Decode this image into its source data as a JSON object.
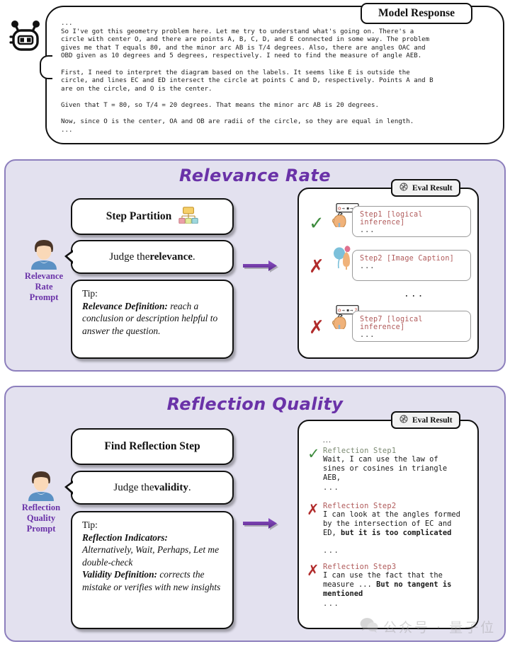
{
  "response": {
    "badge_label": "Model Response",
    "bot_icon": "robot-head-icon",
    "text": "...\nSo I've got this geometry problem here. Let me try to understand what's going on. There's a\ncircle with center O, and there are points A, B, C, D, and E connected in some way. The problem\ngives me that T equals 80, and the minor arc AB is T/4 degrees. Also, there are angles OAC and\nOBD given as 10 degrees and 5 degrees, respectively. I need to find the measure of angle AEB.\n\nFirst, I need to interpret the diagram based on the labels. It seems like E is outside the\ncircle, and lines EC and ED intersect the circle at points C and D, respectively. Points A and B\nare on the circle, and O is the center.\n\nGiven that T = 80, so T/4 = 20 degrees. That means the minor arc AB is 20 degrees.\n\nNow, since O is the center, OA and OB are radii of the circle, so they are equal in length.\n..."
  },
  "relevance": {
    "title": "Relevance Rate",
    "persona": {
      "avatar_icon": "person-avatar-icon",
      "label_line1": "Relevance",
      "label_line2": "Rate",
      "label_line3": "Prompt"
    },
    "step_partition_card": {
      "label": "Step Partition",
      "icon": "hierarchy-chart-icon"
    },
    "judge_card": {
      "prefix": "Judge the ",
      "keyword": "relevance",
      "suffix": "."
    },
    "tip_card": {
      "lead": "Tip:",
      "term": "Relevance Definition:",
      "desc": " reach a conclusion or description helpful to answer the question."
    },
    "arrow_icon": "right-arrow-icon",
    "eval": {
      "badge_label": "Eval Result",
      "badge_icon": "openai-logo-icon",
      "middle_ellipsis": "...",
      "steps": [
        {
          "mark": "check",
          "mark_glyph": "✓",
          "icon": "thinking-head-icon",
          "label": "Step1 [logical inference]",
          "body": "..."
        },
        {
          "mark": "cross",
          "mark_glyph": "✗",
          "icon": "image-caption-icon",
          "label": "Step2 [Image Caption]",
          "body": "..."
        },
        {
          "mark": "cross",
          "mark_glyph": "✗",
          "icon": "thinking-head-icon",
          "label": "Step7 [logical inference]",
          "body": "..."
        }
      ]
    }
  },
  "reflection": {
    "title": "Reflection Quality",
    "persona": {
      "avatar_icon": "person-avatar-icon",
      "label_line1": "Reflection",
      "label_line2": "Quality",
      "label_line3": "Prompt"
    },
    "find_card": {
      "label": "Find Reflection Step"
    },
    "judge_card": {
      "prefix": "Judge the ",
      "keyword": "validity",
      "suffix": "."
    },
    "tip_card": {
      "lead": "Tip:",
      "term1": "Reflection Indicators:",
      "desc1": "Alternatively, Wait, Perhaps, Let me double-check",
      "term2": "Validity Definition:",
      "desc2": " corrects the mistake or verifies with new insights"
    },
    "arrow_icon": "right-arrow-icon",
    "eval": {
      "badge_label": "Eval Result",
      "badge_icon": "openai-logo-icon",
      "top_ellipsis": "...",
      "steps": [
        {
          "mark": "check",
          "mark_glyph": "✓",
          "label": "Reflection Step1",
          "text_plain": "Wait, I can use the law of\nsines or cosines in triangle\nAEB,",
          "text_bold": "",
          "trailing_dots": "..."
        },
        {
          "mark": "cross",
          "mark_glyph": "✗",
          "label": "Reflection Step2",
          "text_plain": "I can look at the angles formed\nby the intersection of EC and\nED, ",
          "text_bold": "but it is too complicated",
          "trailing_dots": "..."
        },
        {
          "mark": "cross",
          "mark_glyph": "✗",
          "label": "Reflection Step3",
          "text_plain": "I can use the fact that the\nmeasure ... ",
          "text_bold": "But no tangent is\nmentioned",
          "trailing_dots": "..."
        }
      ]
    }
  },
  "watermark": {
    "icon": "wechat-icon",
    "text": "公众号 · 量子位"
  },
  "colors": {
    "panel_bg": "#e3e1ef",
    "panel_border": "#8d7fbd",
    "title_purple": "#6a32a8",
    "check_green": "#3d8b3d",
    "cross_red": "#b12b2b",
    "step_label_red": "#b05a5a",
    "refl_ok_label": "#7b8a72"
  }
}
